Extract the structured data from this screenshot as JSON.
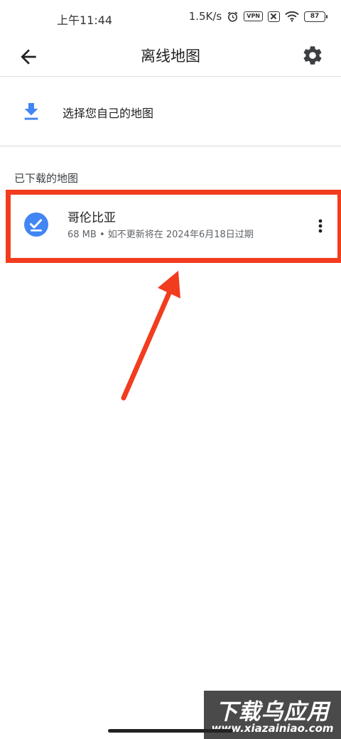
{
  "status_bar": {
    "time": "上午11:44",
    "network_speed": "1.5K/s",
    "vpn_label": "VPN",
    "battery_level": "87"
  },
  "app_bar": {
    "title": "离线地图",
    "back_icon": "arrow-back-icon",
    "settings_icon": "gear-icon"
  },
  "select_map": {
    "label": "选择您自己的地图",
    "icon": "download-icon"
  },
  "downloaded_section": {
    "header": "已下载的地图",
    "items": [
      {
        "name": "哥伦比亚",
        "meta": "68 MB • 如不更新将在 2024年6月18日过期",
        "icon": "check-circle-icon"
      }
    ]
  },
  "watermark": {
    "main": "下载乌应用",
    "sub": "www.xiazainiao.com"
  },
  "colors": {
    "accent_blue": "#4285f4",
    "highlight_red": "#f23c1e",
    "text_primary": "#202124",
    "text_secondary": "#5f6368"
  }
}
